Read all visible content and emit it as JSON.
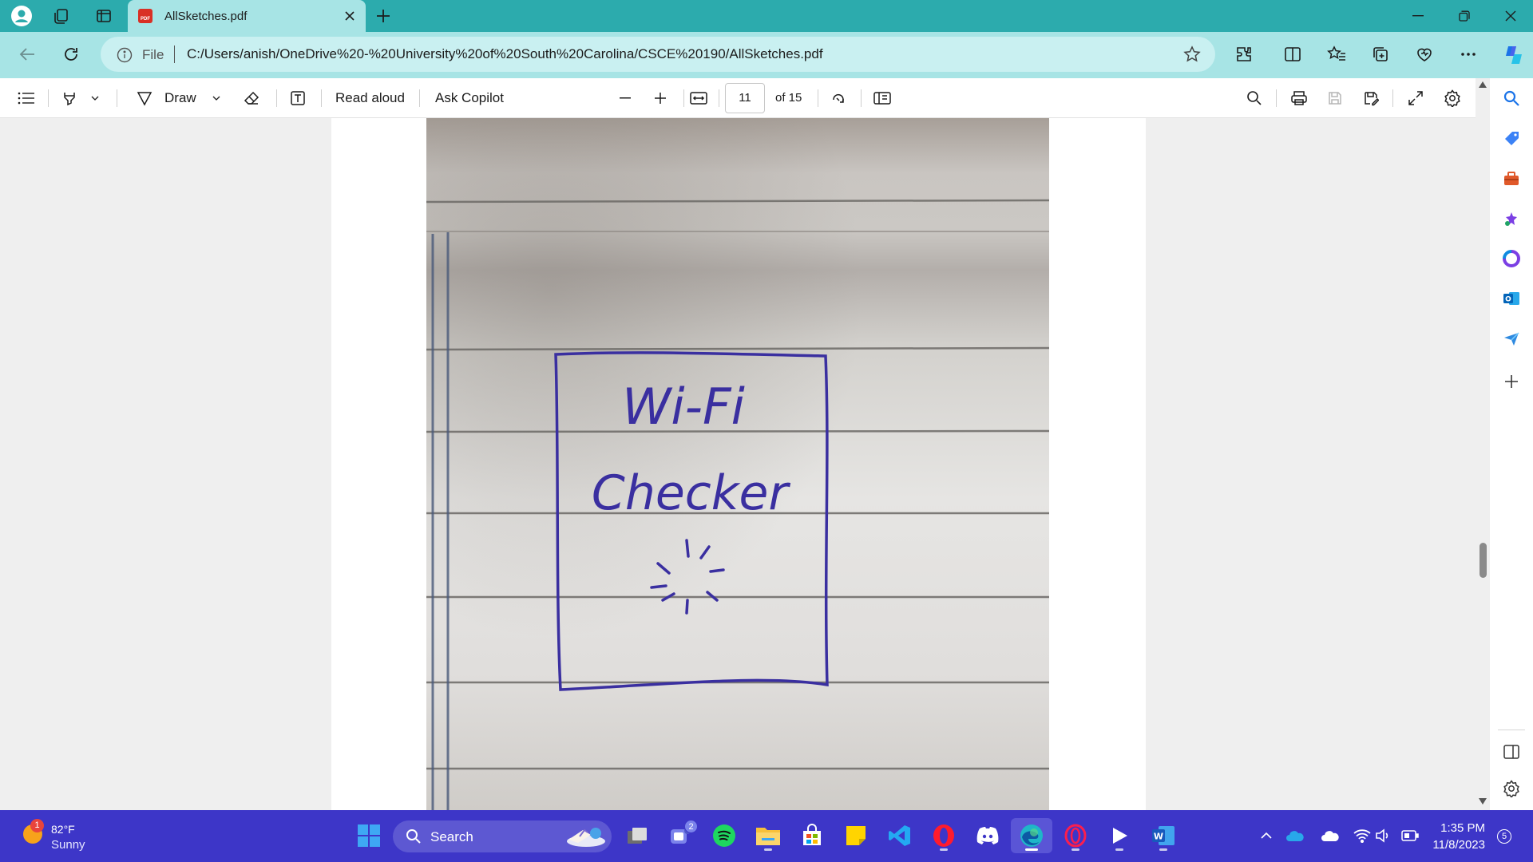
{
  "browser": {
    "tab": {
      "title": "AllSketches.pdf",
      "favicon_text": "PDF"
    },
    "address": {
      "scheme_label": "File",
      "url": "C:/Users/anish/OneDrive%20-%20University%20of%20South%20Carolina/CSCE%20190/AllSketches.pdf"
    }
  },
  "pdf_toolbar": {
    "draw_label": "Draw",
    "read_aloud_label": "Read aloud",
    "ask_copilot_label": "Ask Copilot",
    "current_page": "11",
    "page_total_label": "of 15"
  },
  "document": {
    "sketch_line1": "Wi-Fi",
    "sketch_line2": "Checker"
  },
  "taskbar": {
    "weather": {
      "temp": "82°F",
      "condition": "Sunny",
      "alert_count": "1"
    },
    "search_label": "Search",
    "teams_badge": "2",
    "time": "1:35 PM",
    "date": "11/8/2023",
    "notification_count": "5"
  },
  "colors": {
    "tab_strip": "#2cabad",
    "address_bar": "#a7e4e5",
    "taskbar": "#3d36c8",
    "sketch_ink": "#3a2fa0"
  }
}
